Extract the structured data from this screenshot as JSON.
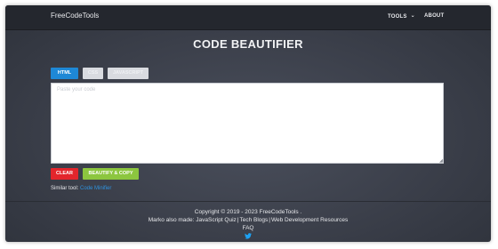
{
  "navbar": {
    "brand": "FreeCodeTools",
    "tools_label": "TOOLS",
    "tools_icon": "chevron-down-icon",
    "about_label": "ABOUT"
  },
  "page": {
    "title": "CODE BEAUTIFIER"
  },
  "tabs": [
    {
      "label": "HTML",
      "active": true
    },
    {
      "label": "CSS",
      "active": false
    },
    {
      "label": "JAVASCRIPT",
      "active": false
    }
  ],
  "editor": {
    "placeholder": "Paste your code",
    "value": ""
  },
  "actions": {
    "clear_label": "CLEAR",
    "beautify_label": "BEAUTIFY & COPY"
  },
  "similar": {
    "prefix": "Similar tool:",
    "link": "Code Minifier"
  },
  "footer": {
    "copyright": "Copyright © 2019 - 2023 FreeCodeTools .",
    "made_prefix": "Marko also made:",
    "links": [
      "JavaScript Quiz",
      "Tech Blogs",
      "Web Development Resources"
    ],
    "faq": "FAQ",
    "social_icon": "twitter-icon"
  },
  "colors": {
    "background": "#3b3f4a",
    "navbar": "#24272e",
    "active_tab": "#1e88d6",
    "clear": "#e3252c",
    "beautify": "#8cc63f",
    "link": "#2f93e0",
    "twitter": "#1da1f2"
  }
}
